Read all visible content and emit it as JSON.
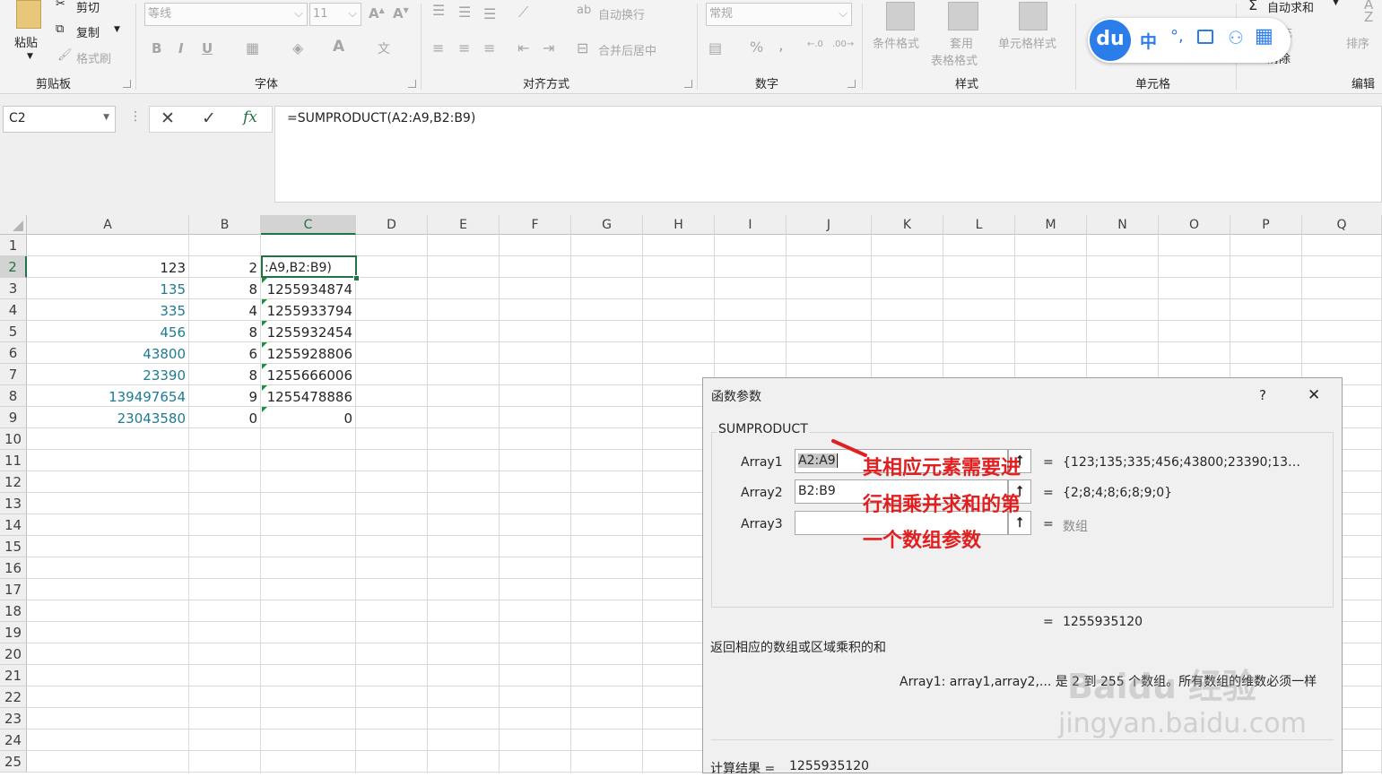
{
  "ribbon": {
    "clipboard": {
      "paste": "粘贴",
      "cut": "剪切",
      "copy": "复制",
      "format_painter": "格式刷",
      "group": "剪贴板"
    },
    "font": {
      "name": "等线",
      "size": "11",
      "bold": "B",
      "italic": "I",
      "underline": "U",
      "group": "字体"
    },
    "alignment": {
      "wrap": "自动换行",
      "merge": "合并后居中",
      "group": "对齐方式"
    },
    "number": {
      "format": "常规",
      "percent": "%",
      "comma": ",",
      "group": "数字"
    },
    "styles": {
      "conditional": "条件格式",
      "table_line1": "套用",
      "table_line2": "表格格式",
      "cell_styles": "单元格样式",
      "group": "样式"
    },
    "cells": {
      "fill": "充",
      "clear": "清除",
      "group": "单元格"
    },
    "editing": {
      "autosum": "自动求和",
      "sort": "排序",
      "group": "编辑"
    }
  },
  "baidu_toolbar": {
    "logo": "du",
    "lang": "中"
  },
  "formula_bar": {
    "name_box": "C2",
    "formula": "=SUMPRODUCT(A2:A9,B2:B9)",
    "fx": "fx"
  },
  "columns": [
    "A",
    "B",
    "C",
    "D",
    "E",
    "F",
    "G",
    "H",
    "I",
    "J",
    "K",
    "L",
    "M",
    "N",
    "O",
    "P",
    "Q"
  ],
  "rows": [
    "1",
    "2",
    "3",
    "4",
    "5",
    "6",
    "7",
    "8",
    "9",
    "10",
    "11",
    "12",
    "13",
    "14",
    "15",
    "16",
    "17",
    "18",
    "19",
    "20",
    "21",
    "22",
    "23",
    "24",
    "25"
  ],
  "cells": {
    "A": [
      "",
      "123",
      "135",
      "335",
      "456",
      "43800",
      "23390",
      "139497654",
      "23043580"
    ],
    "B": [
      "",
      "2",
      "8",
      "4",
      "8",
      "6",
      "8",
      "9",
      "0"
    ],
    "C": [
      "",
      ":A9,B2:B9)",
      "1255934874",
      "1255933794",
      "1255932454",
      "1255928806",
      "1255666006",
      "1255478886",
      "0"
    ]
  },
  "dialog": {
    "title": "函数参数",
    "help": "?",
    "close": "✕",
    "function_name": "SUMPRODUCT",
    "args": [
      {
        "label": "Array1",
        "value": "A2:A9",
        "result": "{123;135;335;456;43800;23390;13…"
      },
      {
        "label": "Array2",
        "value": "B2:B9",
        "result": "{2;8;4;8;6;8;9;0}"
      },
      {
        "label": "Array3",
        "value": "",
        "result": "数组"
      }
    ],
    "eq": "=",
    "total": "1255935120",
    "description": "返回相应的数组或区域乘积的和",
    "arg_help": "Array1:  array1,array2,... 是 2 到 255 个数组。所有数组的维数必须一样",
    "calc_label": "计算结果 =",
    "calc_value": "1255935120"
  },
  "annotation": {
    "line1": "其相应元素需要进",
    "line2": "行相乘并求和的第",
    "line3": "一个数组参数"
  },
  "watermark": {
    "brand": "Baidu 经验",
    "url": "jingyan.baidu.com"
  }
}
